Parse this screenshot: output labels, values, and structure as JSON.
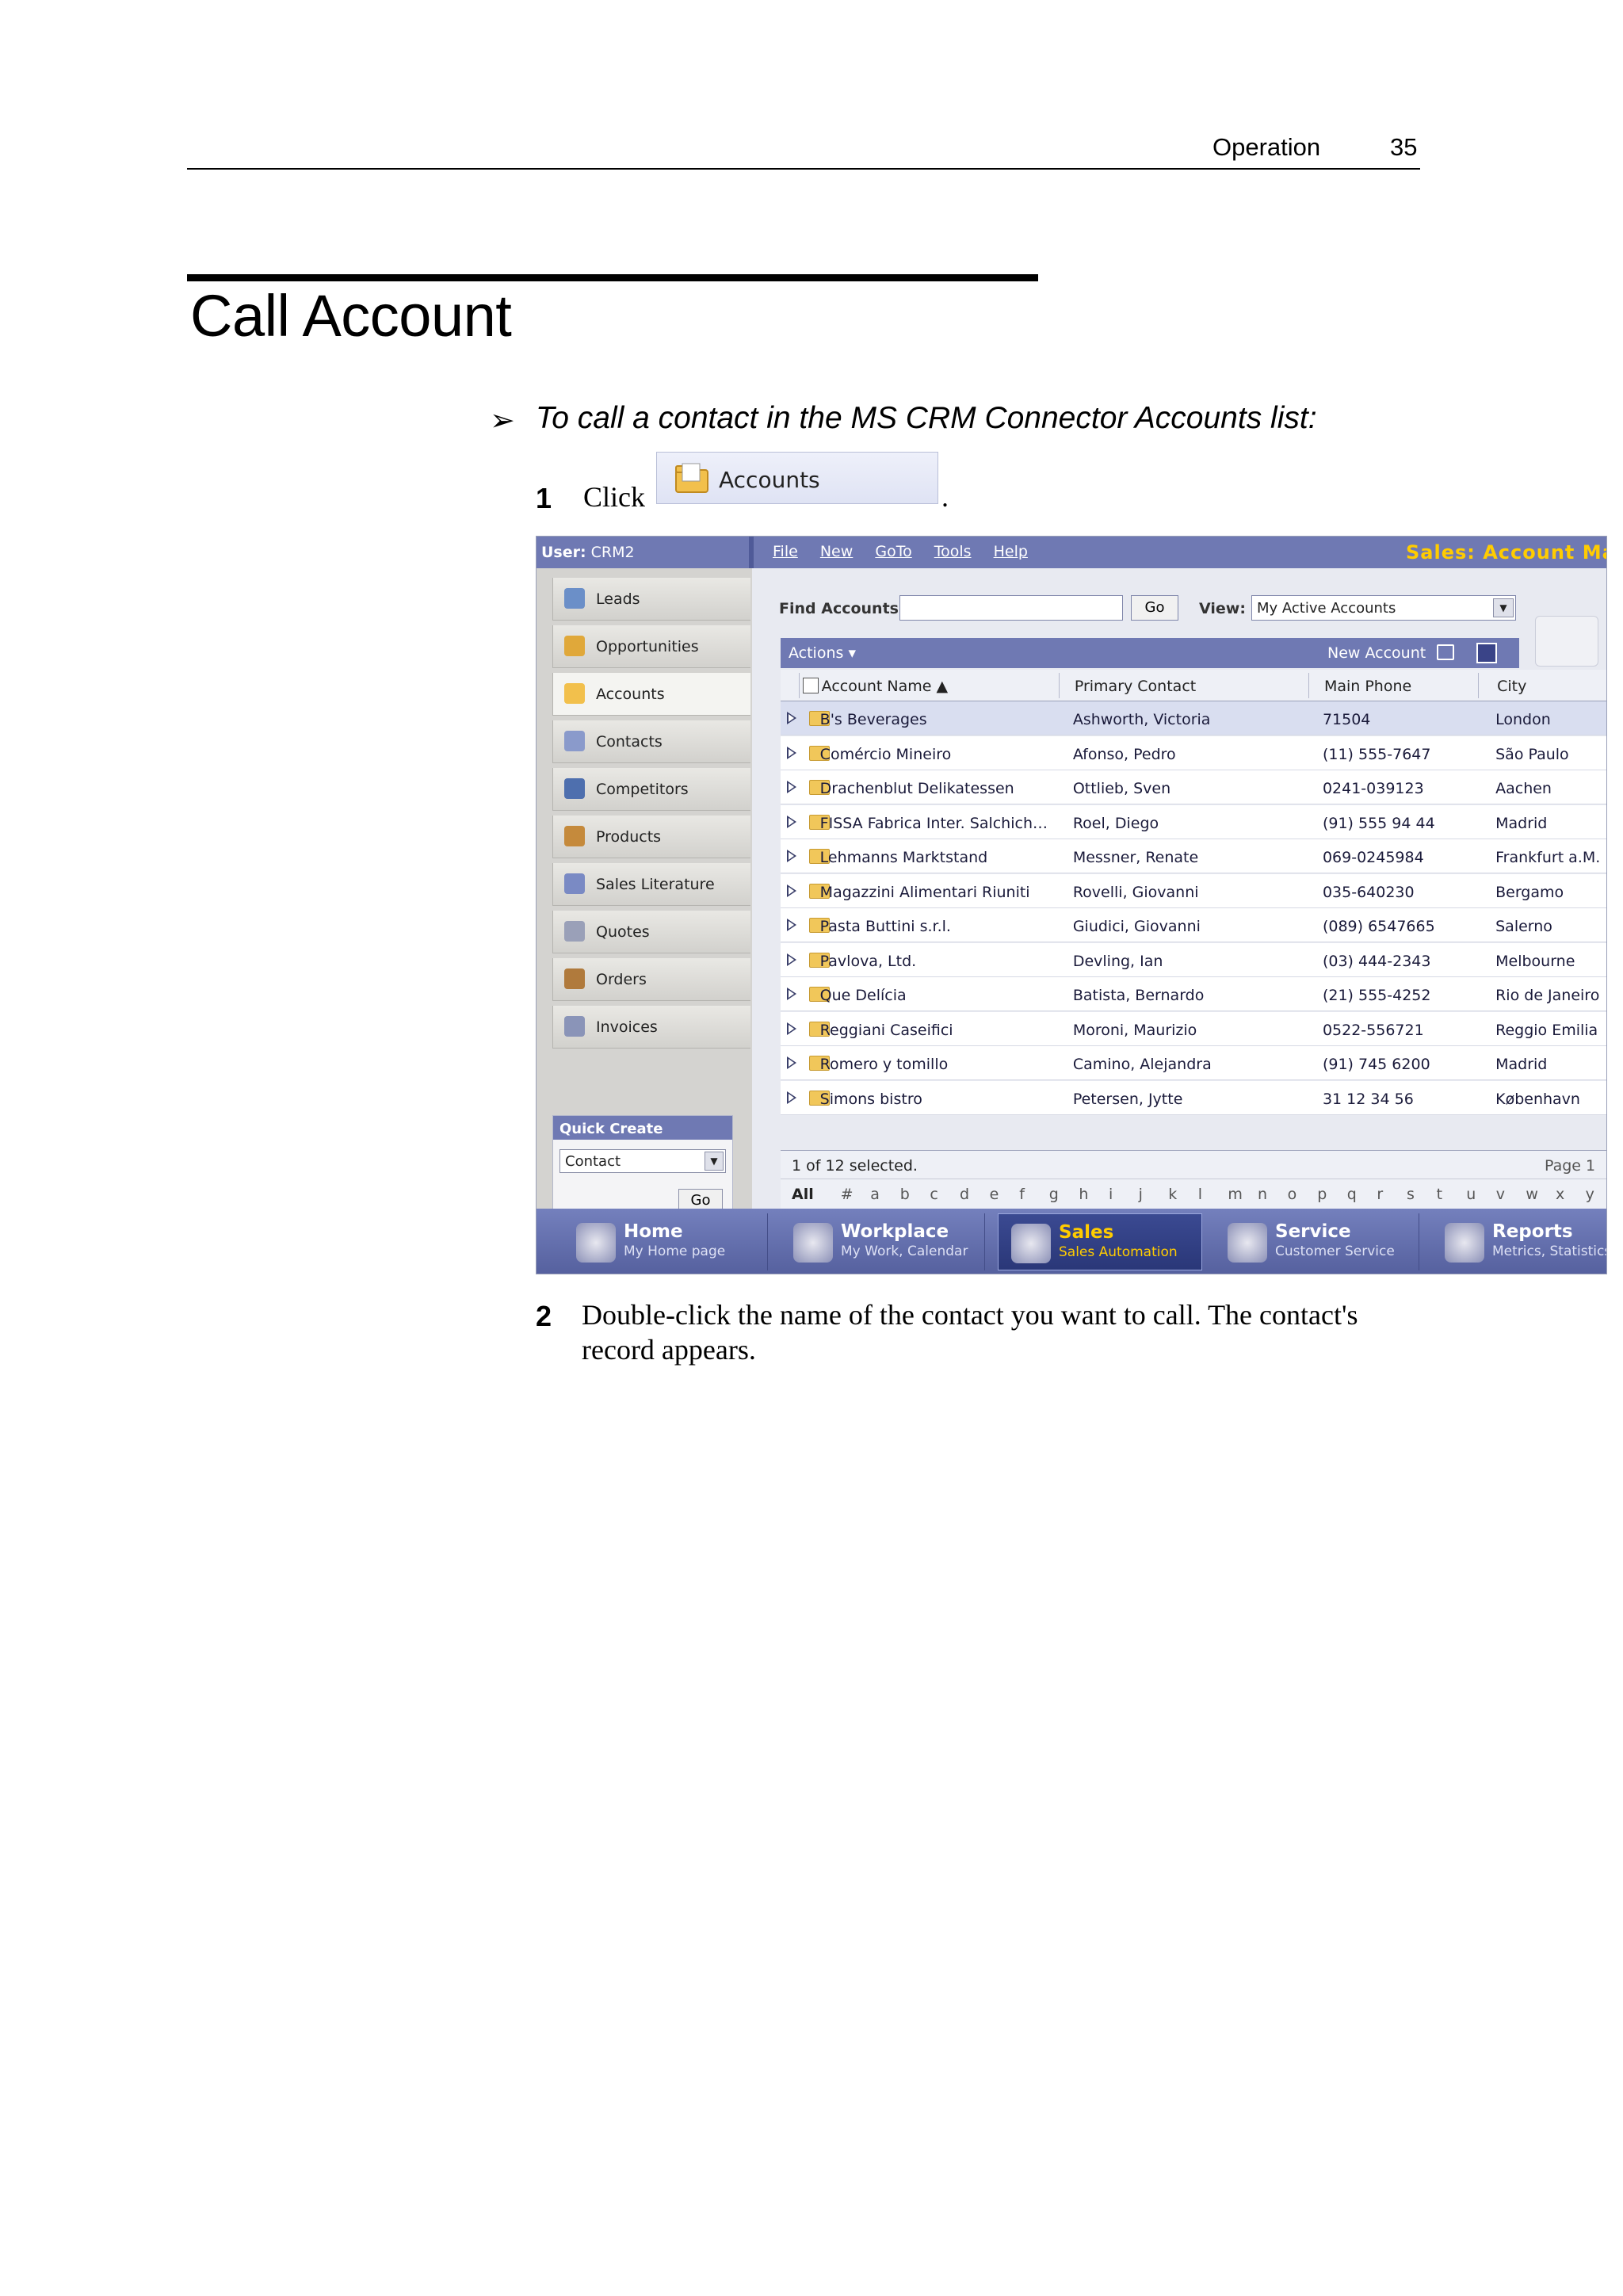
{
  "header": {
    "section": "Operation",
    "page_number": "35"
  },
  "title": "Call Account",
  "procedure": "To call a contact in the MS CRM Connector Accounts list:",
  "steps": [
    {
      "num": "1",
      "text_before": "Click",
      "button_label": "Accounts",
      "text_after": "."
    },
    {
      "num": "2",
      "text": "Double-click the name of the contact you want to call. The contact's",
      "text2": "record appears."
    }
  ],
  "crm": {
    "user_label": "User:",
    "user_value": "CRM2",
    "menu": [
      "File",
      "New",
      "GoTo",
      "Tools",
      "Help"
    ],
    "app_title": "Sales: Account Mana",
    "nav": [
      {
        "label": "Leads",
        "icon": "leads-icon"
      },
      {
        "label": "Opportunities",
        "icon": "opportunities-icon"
      },
      {
        "label": "Accounts",
        "icon": "accounts-icon"
      },
      {
        "label": "Contacts",
        "icon": "contacts-icon"
      },
      {
        "label": "Competitors",
        "icon": "competitors-icon"
      },
      {
        "label": "Products",
        "icon": "products-icon"
      },
      {
        "label": "Sales Literature",
        "icon": "sales-literature-icon"
      },
      {
        "label": "Quotes",
        "icon": "quotes-icon"
      },
      {
        "label": "Orders",
        "icon": "orders-icon"
      },
      {
        "label": "Invoices",
        "icon": "invoices-icon"
      }
    ],
    "active_nav": "Accounts",
    "quick_create": {
      "title": "Quick Create",
      "selected": "Contact",
      "go": "Go"
    },
    "find": {
      "label": "Find Accounts:",
      "value": "",
      "go": "Go"
    },
    "view": {
      "label": "View:",
      "selected": "My Active Accounts"
    },
    "actions": {
      "label": "Actions ▾",
      "new_account": "New Account"
    },
    "columns": [
      "Account Name ▲",
      "Primary Contact",
      "Main Phone",
      "City"
    ],
    "rows": [
      [
        "B's Beverages",
        "Ashworth, Victoria",
        "71504",
        "London"
      ],
      [
        "Comércio Mineiro",
        "Afonso, Pedro",
        "(11) 555-7647",
        "São Paulo"
      ],
      [
        "Drachenblut Delikatessen",
        "Ottlieb, Sven",
        "0241-039123",
        "Aachen"
      ],
      [
        "FISSA Fabrica Inter. Salchich…",
        "Roel, Diego",
        "(91) 555 94 44",
        "Madrid"
      ],
      [
        "Lehmanns Marktstand",
        "Messner, Renate",
        "069-0245984",
        "Frankfurt a.M."
      ],
      [
        "Magazzini Alimentari Riuniti",
        "Rovelli, Giovanni",
        "035-640230",
        "Bergamo"
      ],
      [
        "Pasta Buttini s.r.l.",
        "Giudici, Giovanni",
        "(089) 6547665",
        "Salerno"
      ],
      [
        "Pavlova, Ltd.",
        "Devling, Ian",
        "(03) 444-2343",
        "Melbourne"
      ],
      [
        "Que Delícia",
        "Batista, Bernardo",
        "(21) 555-4252",
        "Rio de Janeiro"
      ],
      [
        "Reggiani Caseifici",
        "Moroni, Maurizio",
        "0522-556721",
        "Reggio Emilia"
      ],
      [
        "Romero y tomillo",
        "Camino, Alejandra",
        "(91) 745 6200",
        "Madrid"
      ],
      [
        "Simons bistro",
        "Petersen, Jytte",
        "31 12 34 56",
        "København"
      ]
    ],
    "selected_row": 0,
    "status": "1 of 12 selected.",
    "page": "Page 1",
    "alphabet": [
      "All",
      "#",
      "a",
      "b",
      "c",
      "d",
      "e",
      "f",
      "g",
      "h",
      "i",
      "j",
      "k",
      "l",
      "m",
      "n",
      "o",
      "p",
      "q",
      "r",
      "s",
      "t",
      "u",
      "v",
      "w",
      "x",
      "y"
    ],
    "tabs": [
      {
        "title": "Home",
        "sub": "My Home page",
        "icon": "home-target-icon"
      },
      {
        "title": "Workplace",
        "sub": "My Work, Calendar",
        "icon": "workplace-icon"
      },
      {
        "title": "Sales",
        "sub": "Sales Automation",
        "icon": "sales-icon"
      },
      {
        "title": "Service",
        "sub": "Customer Service",
        "icon": "service-icon"
      },
      {
        "title": "Reports",
        "sub": "Metrics, Statistics",
        "icon": "reports-pie-icon"
      }
    ],
    "selected_tab": "Sales",
    "colors": {
      "bar": "#6f79b3",
      "accent_yellow": "#ffcc00",
      "selected_row": "#d9def0"
    }
  }
}
